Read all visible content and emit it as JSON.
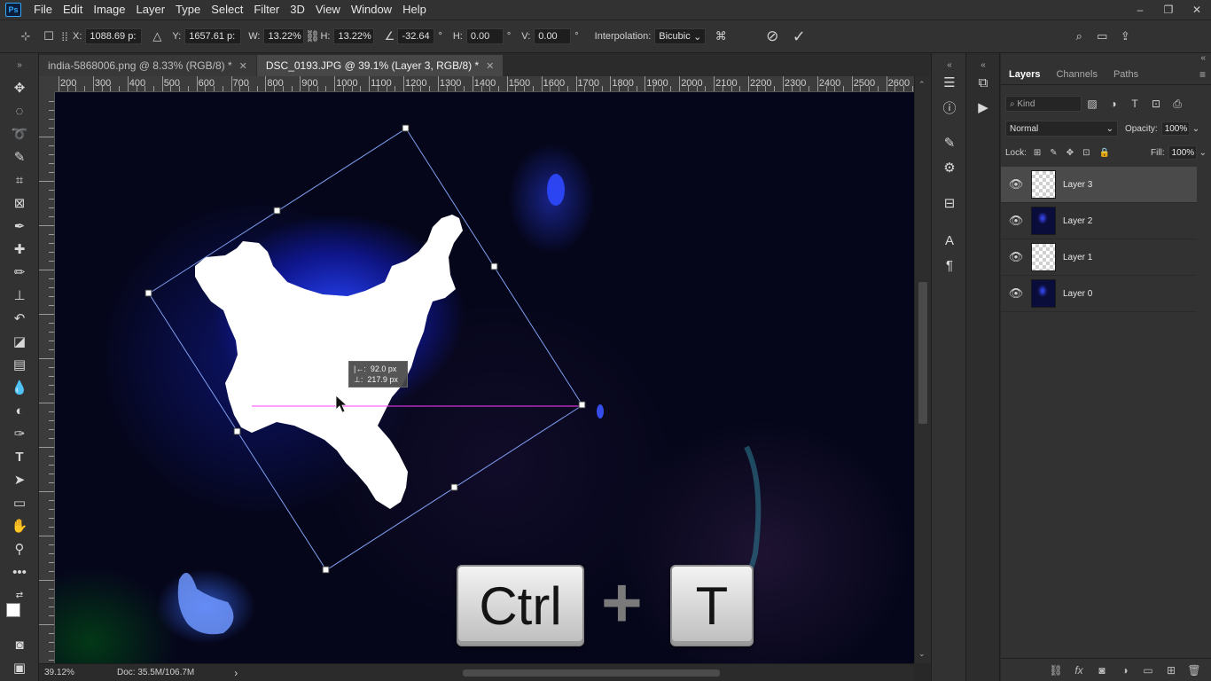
{
  "menu": [
    "File",
    "Edit",
    "Image",
    "Layer",
    "Type",
    "Select",
    "Filter",
    "3D",
    "View",
    "Window",
    "Help"
  ],
  "app_logo": "Ps",
  "window_controls": [
    "–",
    "❐",
    "✕"
  ],
  "options": {
    "x_label": "X:",
    "x_value": "1088.69 p:",
    "y_label": "Y:",
    "y_value": "1657.61 p:",
    "w_label": "W:",
    "w_value": "13.22%",
    "h_label": "H:",
    "h_value": "13.22%",
    "angle_value": "-32.64",
    "angle_unit": "°",
    "hskew_label": "H:",
    "hskew_value": "0.00",
    "hskew_unit": "°",
    "vskew_label": "V:",
    "vskew_value": "0.00",
    "vskew_unit": "°",
    "interp_label": "Interpolation:",
    "interp_value": "Bicubic"
  },
  "tabs": [
    {
      "label": "india-5868006.png @ 8.33% (RGB/8) *",
      "close": "✕"
    },
    {
      "label": "DSC_0193.JPG @ 39.1% (Layer 3, RGB/8) *",
      "close": "✕"
    }
  ],
  "ruler_labels": [
    "200",
    "300",
    "400",
    "500",
    "600",
    "700",
    "800",
    "900",
    "1000",
    "1100",
    "1200",
    "1300",
    "1400",
    "1500",
    "1600",
    "1700",
    "1800",
    "1900",
    "2000",
    "2100",
    "2200",
    "2300",
    "2400",
    "2500",
    "2600"
  ],
  "transform_info": {
    "dx_label": "|←:",
    "dx": "92.0 px",
    "dy_label": "⊥:",
    "dy": "217.9 px"
  },
  "keys": {
    "ctrl": "Ctrl",
    "plus": "+",
    "t": "T"
  },
  "status": {
    "zoom": "39.12%",
    "doc": "Doc: 35.5M/106.7M",
    "arrow": "›"
  },
  "layers_panel": {
    "tabs": [
      "Layers",
      "Channels",
      "Paths"
    ],
    "kind_placeholder": "Kind",
    "blend_mode": "Normal",
    "opacity_label": "Opacity:",
    "opacity_value": "100%",
    "lock_label": "Lock:",
    "fill_label": "Fill:",
    "fill_value": "100%",
    "layers": [
      {
        "name": "Layer 3",
        "thumb": "checker",
        "selected": true
      },
      {
        "name": "Layer 2",
        "thumb": "photo",
        "selected": false
      },
      {
        "name": "Layer 1",
        "thumb": "checker",
        "selected": false
      },
      {
        "name": "Layer 0",
        "thumb": "photo",
        "selected": false
      }
    ]
  },
  "icons": {
    "toolbar": [
      "move-icon",
      "marquee-icon",
      "lasso-icon",
      "quick-select-icon",
      "crop-icon",
      "frame-icon",
      "eyedropper-icon",
      "healing-icon",
      "brush-icon",
      "stamp-icon",
      "history-brush-icon",
      "eraser-icon",
      "gradient-icon",
      "blur-icon",
      "dodge-icon",
      "pen-icon",
      "type-icon",
      "path-select-icon",
      "shape-icon",
      "hand-icon",
      "zoom-icon",
      "more-icon"
    ]
  },
  "colors": {
    "accent": "#31a8ff",
    "guide": "#ff3cff",
    "bbox": "#6f8fe0",
    "selection": "#4a4a4a"
  }
}
